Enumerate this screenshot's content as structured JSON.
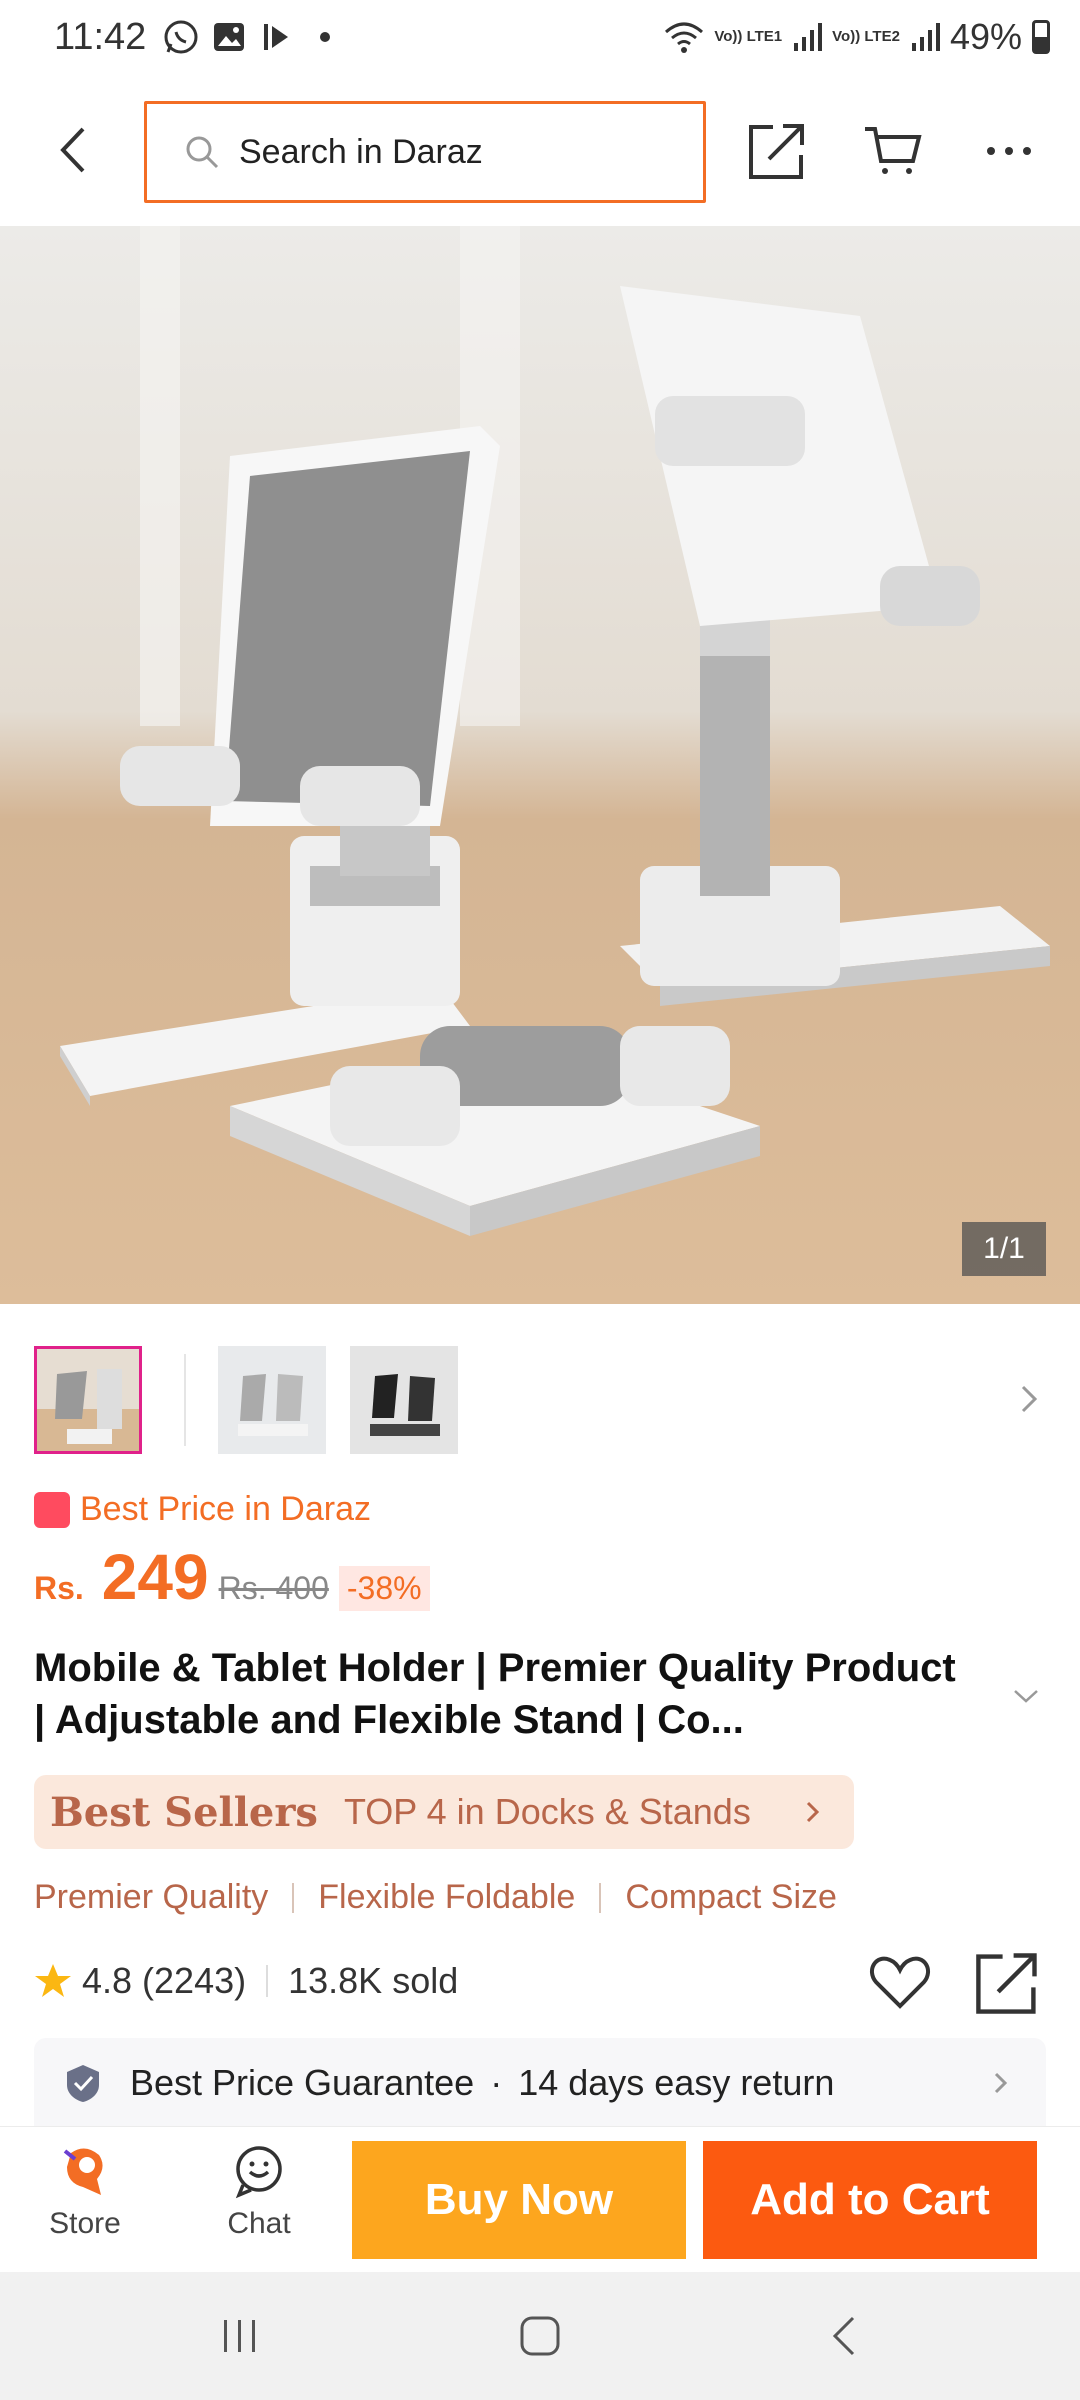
{
  "status_bar": {
    "time": "11:42",
    "lte1": "Vo)) LTE1",
    "lte2": "Vo)) LTE2",
    "battery": "49%",
    "battery_level": 0.49
  },
  "header": {
    "search_placeholder": "Search in Daraz",
    "icons": [
      "back-icon",
      "share-icon",
      "cart-icon",
      "more-icon"
    ]
  },
  "product": {
    "image_counter": "1/1",
    "thumbnails": [
      "thumbnail-1",
      "thumbnail-2",
      "thumbnail-3"
    ],
    "best_price_label": "Best Price in Daraz",
    "currency": "Rs.",
    "price": "249",
    "original_price": "Rs. 400",
    "discount": "-38%",
    "title": "Mobile & Tablet Holder | Premier Quality Product | Adjustable and Flexible Stand | Co...",
    "best_sellers_label": "Best Sellers",
    "best_sellers_rank": "TOP 4 in Docks & Stands",
    "tags": [
      "Premier Quality",
      "Flexible Foldable",
      "Compact Size"
    ],
    "rating": "4.8 (2243)",
    "sold": "13.8K sold",
    "guarantee": "Best Price Guarantee",
    "returns": "14 days easy return"
  },
  "bottom_bar": {
    "store_label": "Store",
    "chat_label": "Chat",
    "buy_now": "Buy Now",
    "add_to_cart": "Add to Cart"
  },
  "colors": {
    "accent": "#f36d24",
    "buy_now": "#fda61e",
    "add_to_cart": "#fc5a10"
  }
}
